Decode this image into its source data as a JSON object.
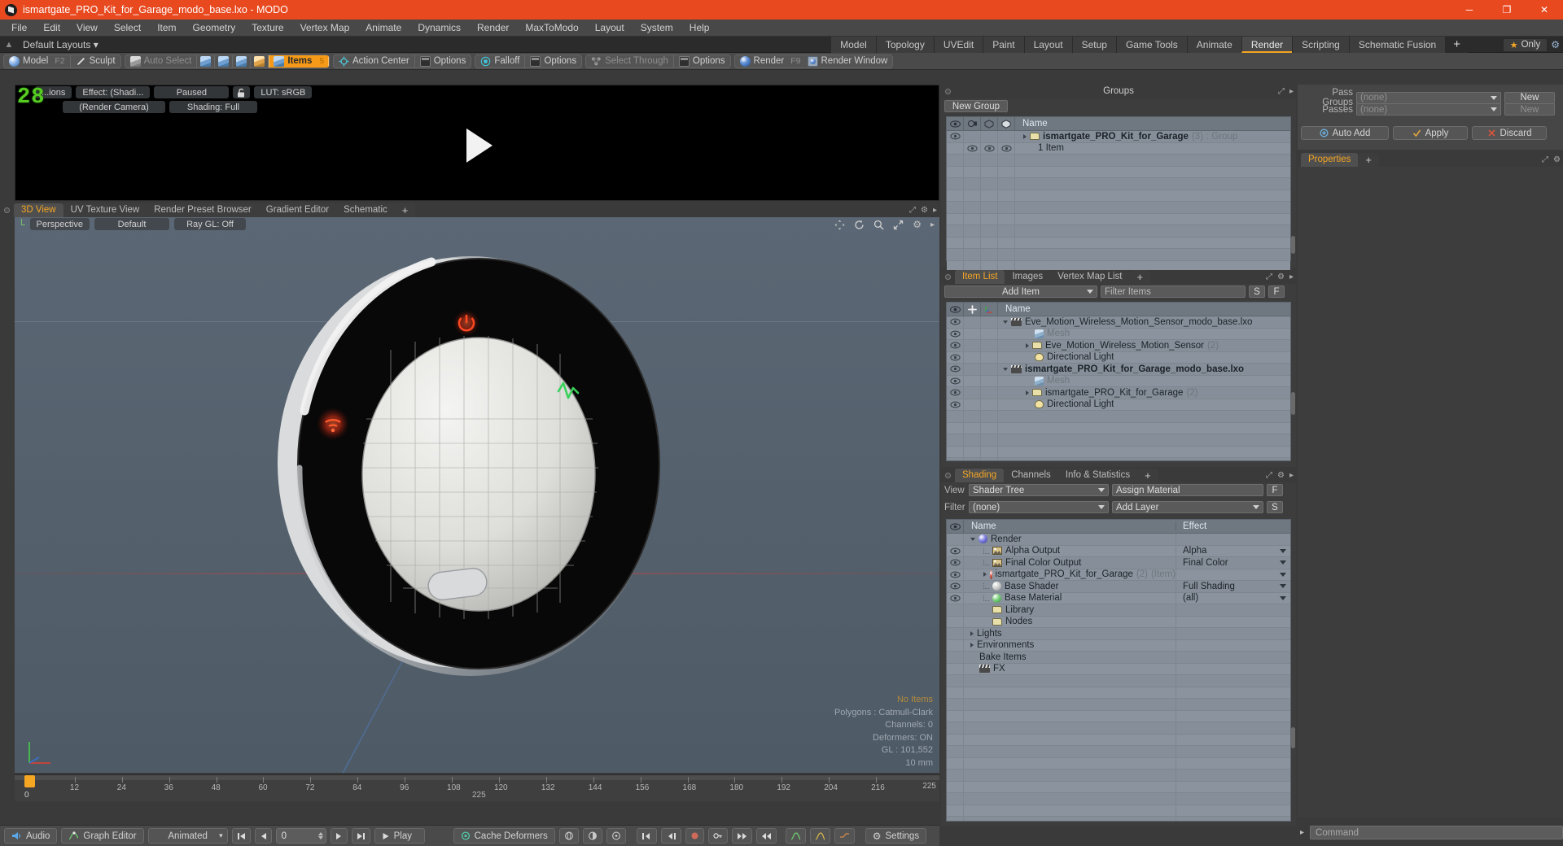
{
  "window": {
    "title": "ismartgate_PRO_Kit_for_Garage_modo_base.lxo - MODO",
    "minimize": "─",
    "maximize": "❐",
    "close": "✕"
  },
  "menu": {
    "items": [
      "File",
      "Edit",
      "View",
      "Select",
      "Item",
      "Geometry",
      "Texture",
      "Vertex Map",
      "Animate",
      "Dynamics",
      "Render",
      "MaxToModo",
      "Layout",
      "System",
      "Help"
    ]
  },
  "layoutbar": {
    "default_layouts": "Default Layouts",
    "tabs": [
      {
        "label": "Model",
        "active": false
      },
      {
        "label": "Topology",
        "active": false
      },
      {
        "label": "UVEdit",
        "active": false
      },
      {
        "label": "Paint",
        "active": false
      },
      {
        "label": "Layout",
        "active": false
      },
      {
        "label": "Setup",
        "active": false
      },
      {
        "label": "Game Tools",
        "active": false
      },
      {
        "label": "Animate",
        "active": false
      },
      {
        "label": "Render",
        "active": true
      },
      {
        "label": "Scripting",
        "active": false
      },
      {
        "label": "Schematic Fusion",
        "active": false
      }
    ],
    "add_tab": "+",
    "only_label": "Only"
  },
  "toolbar": {
    "model": "Model",
    "model_hotkey": "F2",
    "sculpt": "Sculpt",
    "auto_select": "Auto Select",
    "items": "Items",
    "items_hotkey": "5",
    "action_center": "Action Center",
    "options_1": "Options",
    "falloff": "Falloff",
    "options_2": "Options",
    "select_through": "Select Through",
    "options_3": "Options",
    "render": "Render",
    "render_hotkey": "F9",
    "render_window": "Render Window"
  },
  "preview": {
    "frame_number": "28",
    "options": "...ions",
    "effect": "Effect: (Shadi...",
    "paused": "Paused",
    "lut": "LUT: sRGB",
    "render_camera": "(Render Camera)",
    "shading": "Shading: Full"
  },
  "viewport": {
    "tabs": [
      {
        "label": "3D View",
        "active": true
      },
      {
        "label": "UV Texture View",
        "active": false
      },
      {
        "label": "Render Preset Browser",
        "active": false
      },
      {
        "label": "Gradient Editor",
        "active": false
      },
      {
        "label": "Schematic",
        "active": false
      },
      {
        "label": "+",
        "active": false
      }
    ],
    "perspective": "Perspective",
    "shading_mode": "Default",
    "raygl": "Ray GL: Off",
    "stats": {
      "no_items": "No Items",
      "polygons": "Polygons : Catmull-Clark",
      "channels": "Channels: 0",
      "deformers": "Deformers: ON",
      "gl": "GL : 101,552",
      "scale": "10 mm"
    }
  },
  "groups_panel": {
    "title": "Groups",
    "new_group_button": "New Group",
    "columns": [
      "eye",
      "render",
      "cube1",
      "cube2",
      "Name"
    ],
    "rows": [
      {
        "name": "ismartgate_PRO_Kit_for_Garage",
        "count": "(3)",
        "suffix": ": Group",
        "bold": true,
        "indent": 0
      },
      {
        "name": "1 Item",
        "count": "",
        "suffix": "",
        "bold": false,
        "indent": 1
      }
    ]
  },
  "itemlist_panel": {
    "tabs": [
      {
        "label": "Item List",
        "active": true
      },
      {
        "label": "Images",
        "active": false
      },
      {
        "label": "Vertex Map List",
        "active": false
      },
      {
        "label": "+",
        "active": false
      }
    ],
    "add_item": "Add Item",
    "filter_items_placeholder": "Filter Items",
    "btn_s": "S",
    "btn_f": "F",
    "columns": [
      "eye",
      "lock",
      "axis",
      "Name"
    ],
    "rows": [
      {
        "name": "Eve_Motion_Wireless_Motion_Sensor_modo_base.lxo",
        "count": "",
        "indent": 0,
        "icon": "clapper",
        "bold": false,
        "dim": false,
        "twirl": "down",
        "eye": true
      },
      {
        "name": "Mesh",
        "count": "",
        "indent": 2,
        "icon": "mesh",
        "bold": false,
        "dim": true,
        "twirl": "",
        "eye": true
      },
      {
        "name": "Eve_Motion_Wireless_Motion_Sensor",
        "count": "(2)",
        "indent": 2,
        "icon": "folder",
        "bold": false,
        "dim": false,
        "twirl": "right",
        "eye": true
      },
      {
        "name": "Directional Light",
        "count": "",
        "indent": 2,
        "icon": "light",
        "bold": false,
        "dim": false,
        "twirl": "",
        "eye": true
      },
      {
        "name": "ismartgate_PRO_Kit_for_Garage_modo_base.lxo",
        "count": "",
        "indent": 0,
        "icon": "clapper",
        "bold": true,
        "dim": false,
        "twirl": "down",
        "eye": true
      },
      {
        "name": "Mesh",
        "count": "",
        "indent": 2,
        "icon": "mesh",
        "bold": false,
        "dim": true,
        "twirl": "",
        "eye": true
      },
      {
        "name": "ismartgate_PRO_Kit_for_Garage",
        "count": "(2)",
        "indent": 2,
        "icon": "folder",
        "bold": false,
        "dim": false,
        "twirl": "right",
        "eye": true
      },
      {
        "name": "Directional Light",
        "count": "",
        "indent": 2,
        "icon": "light",
        "bold": false,
        "dim": false,
        "twirl": "",
        "eye": true
      }
    ]
  },
  "shading_panel": {
    "tabs": [
      {
        "label": "Shading",
        "active": true
      },
      {
        "label": "Channels",
        "active": false
      },
      {
        "label": "Info & Statistics",
        "active": false
      },
      {
        "label": "+",
        "active": false
      }
    ],
    "view_label": "View",
    "view_value": "Shader Tree",
    "assign_material": "Assign Material",
    "btn_f": "F",
    "filter_label": "Filter",
    "filter_value": "(none)",
    "add_layer": "Add Layer",
    "btn_s": "S",
    "columns": {
      "name": "Name",
      "effect": "Effect"
    },
    "rows": [
      {
        "name": "Render",
        "count": "",
        "suffix": "",
        "effect": "",
        "indent": 0,
        "icon": "ball-blue",
        "twirl": "down",
        "eye": false,
        "dropdown": false
      },
      {
        "name": "Alpha Output",
        "count": "",
        "suffix": "",
        "effect": "Alpha",
        "indent": 1,
        "icon": "image",
        "twirl": "dash",
        "eye": true,
        "dropdown": true
      },
      {
        "name": "Final Color Output",
        "count": "",
        "suffix": "",
        "effect": "Final Color",
        "indent": 1,
        "icon": "image",
        "twirl": "dash",
        "eye": true,
        "dropdown": true
      },
      {
        "name": "ismartgate_PRO_Kit_for_Garage",
        "count": "(2)",
        "suffix": "(Item)",
        "effect": "",
        "indent": 1,
        "icon": "ball-red",
        "twirl": "right",
        "eye": true,
        "dropdown": true
      },
      {
        "name": "Base Shader",
        "count": "",
        "suffix": "",
        "effect": "Full Shading",
        "indent": 1,
        "icon": "ball-grey",
        "twirl": "dash",
        "eye": true,
        "dropdown": true
      },
      {
        "name": "Base Material",
        "count": "",
        "suffix": "",
        "effect": "(all)",
        "indent": 1,
        "icon": "ball-green",
        "twirl": "dash",
        "eye": true,
        "dropdown": true
      },
      {
        "name": "Library",
        "count": "",
        "suffix": "",
        "effect": "",
        "indent": 1,
        "icon": "folder",
        "twirl": "",
        "eye": false,
        "dropdown": false
      },
      {
        "name": "Nodes",
        "count": "",
        "suffix": "",
        "effect": "",
        "indent": 1,
        "icon": "folder",
        "twirl": "",
        "eye": false,
        "dropdown": false
      },
      {
        "name": "Lights",
        "count": "",
        "suffix": "",
        "effect": "",
        "indent": 0,
        "icon": "none",
        "twirl": "right",
        "eye": false,
        "dropdown": false
      },
      {
        "name": "Environments",
        "count": "",
        "suffix": "",
        "effect": "",
        "indent": 0,
        "icon": "none",
        "twirl": "right",
        "eye": false,
        "dropdown": false
      },
      {
        "name": "Bake Items",
        "count": "",
        "suffix": "",
        "effect": "",
        "indent": 0,
        "icon": "none",
        "twirl": "",
        "eye": false,
        "dropdown": false
      },
      {
        "name": "FX",
        "count": "",
        "suffix": "",
        "effect": "",
        "indent": 0,
        "icon": "clapper",
        "twirl": "",
        "eye": false,
        "dropdown": false
      }
    ]
  },
  "passes_panel": {
    "pass_groups_label": "Pass Groups",
    "pass_groups_value": "(none)",
    "passes_label": "Passes",
    "passes_value": "(none)",
    "new_button_1": "New",
    "new_button_2": "New",
    "auto_add": "Auto Add",
    "apply": "Apply",
    "discard": "Discard"
  },
  "properties_panel": {
    "tabs": [
      {
        "label": "Properties",
        "active": true
      },
      {
        "label": "+",
        "active": false
      }
    ]
  },
  "timeline": {
    "ticks": [
      "12",
      "24",
      "36",
      "48",
      "60",
      "72",
      "84",
      "96",
      "108",
      "120",
      "132",
      "144",
      "156",
      "168",
      "180",
      "192",
      "204",
      "216"
    ],
    "start": "0",
    "end_label": "225",
    "end_right": "225",
    "playhead_frame": "0"
  },
  "bottombar": {
    "audio": "Audio",
    "graph_editor": "Graph Editor",
    "animated": "Animated",
    "frame_value": "0",
    "play": "Play",
    "cache_deformers": "Cache Deformers",
    "settings": "Settings"
  },
  "command": {
    "placeholder": "Command"
  },
  "colors": {
    "title_bar": "#e8491f",
    "accent": "#f5a623",
    "panel_bg": "#3d3d3d",
    "toolbar_bg": "#4a4a4a",
    "list_bg": "#868f99",
    "viewport_bg": "#54606c"
  }
}
